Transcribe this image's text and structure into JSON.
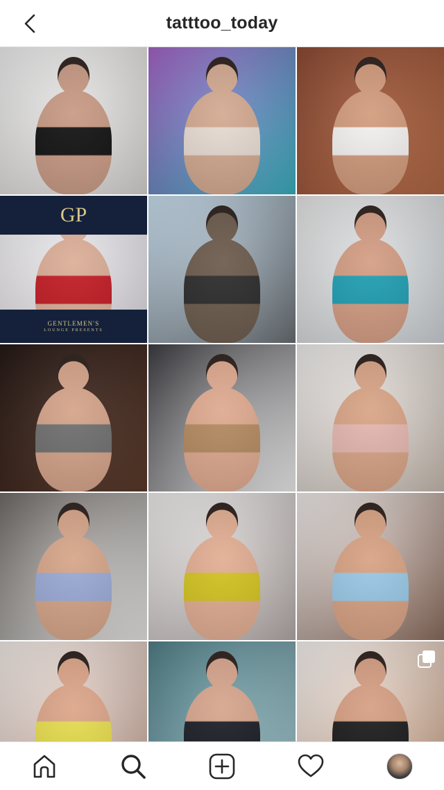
{
  "header": {
    "title": "tatttoo_today",
    "back_icon": "chevron-left-icon"
  },
  "grid": {
    "tiles": [
      {
        "name": "post-1",
        "bg": [
          "#efefef",
          "#d9d6d4"
        ],
        "skin": "#c89a84",
        "top": "#111111"
      },
      {
        "name": "post-2",
        "bg": [
          "#a463c6",
          "#3ab3c0"
        ],
        "skin": "#d3a990",
        "top": "#e8dcd2"
      },
      {
        "name": "post-3",
        "bg": [
          "#8c4a33",
          "#b56a45"
        ],
        "skin": "#d29b7c",
        "top": "#f5f3f1"
      },
      {
        "name": "post-4",
        "bg": [
          "#f2f1f3",
          "#dcd9df"
        ],
        "skin": "#dcae97",
        "top": "#c31b23",
        "brand_top": "GP",
        "brand_bottom": "GENTLEMEN'S",
        "brand_sub": "LOUNGE PRESENTS"
      },
      {
        "name": "post-5",
        "bg": [
          "#cbe1f1",
          "#6a6f74"
        ],
        "skin": "#6b5a4c",
        "top": "#2b2b2b"
      },
      {
        "name": "post-6",
        "bg": [
          "#e7e7e7",
          "#cfd4d8"
        ],
        "skin": "#d49d83",
        "top": "#1f9fb3"
      },
      {
        "name": "post-7",
        "bg": [
          "#241714",
          "#5c3a2a"
        ],
        "skin": "#d5a389",
        "top": "#6f6f6f"
      },
      {
        "name": "post-8",
        "bg": [
          "#3c3b40",
          "#f2f2f2"
        ],
        "skin": "#dfa98f",
        "top": "#b48a60"
      },
      {
        "name": "post-9",
        "bg": [
          "#f1efee",
          "#c9bdb3"
        ],
        "skin": "#d9a486",
        "top": "#e6b7b0"
      },
      {
        "name": "post-10",
        "bg": [
          "#6f6a66",
          "#e9e8e7"
        ],
        "skin": "#d6a589",
        "top": "#9aaad6"
      },
      {
        "name": "post-11",
        "bg": [
          "#efeeed",
          "#b5acaa"
        ],
        "skin": "#e2ad92",
        "top": "#d3c31f"
      },
      {
        "name": "post-12",
        "bg": [
          "#f1edec",
          "#8c6d5e"
        ],
        "skin": "#d8a283",
        "top": "#99c8e6"
      },
      {
        "name": "post-13",
        "bg": [
          "#f3ece8",
          "#c7a799"
        ],
        "skin": "#dca588",
        "top": "#e7dd4e"
      },
      {
        "name": "post-14",
        "bg": [
          "#4f7e87",
          "#a3c5cc"
        ],
        "skin": "#d7a58d",
        "top": "#1a1d24"
      },
      {
        "name": "post-15",
        "bg": [
          "#f6f3f1",
          "#caa388"
        ],
        "skin": "#d69f83",
        "top": "#1b1b1b",
        "multi": true
      }
    ]
  },
  "bottom_nav": {
    "items": [
      {
        "name": "home-icon"
      },
      {
        "name": "search-icon"
      },
      {
        "name": "add-post-icon"
      },
      {
        "name": "heart-icon"
      },
      {
        "name": "profile-avatar"
      }
    ]
  },
  "colors": {
    "text": "#262626",
    "border": "#dbdbdb",
    "background": "#ffffff"
  }
}
